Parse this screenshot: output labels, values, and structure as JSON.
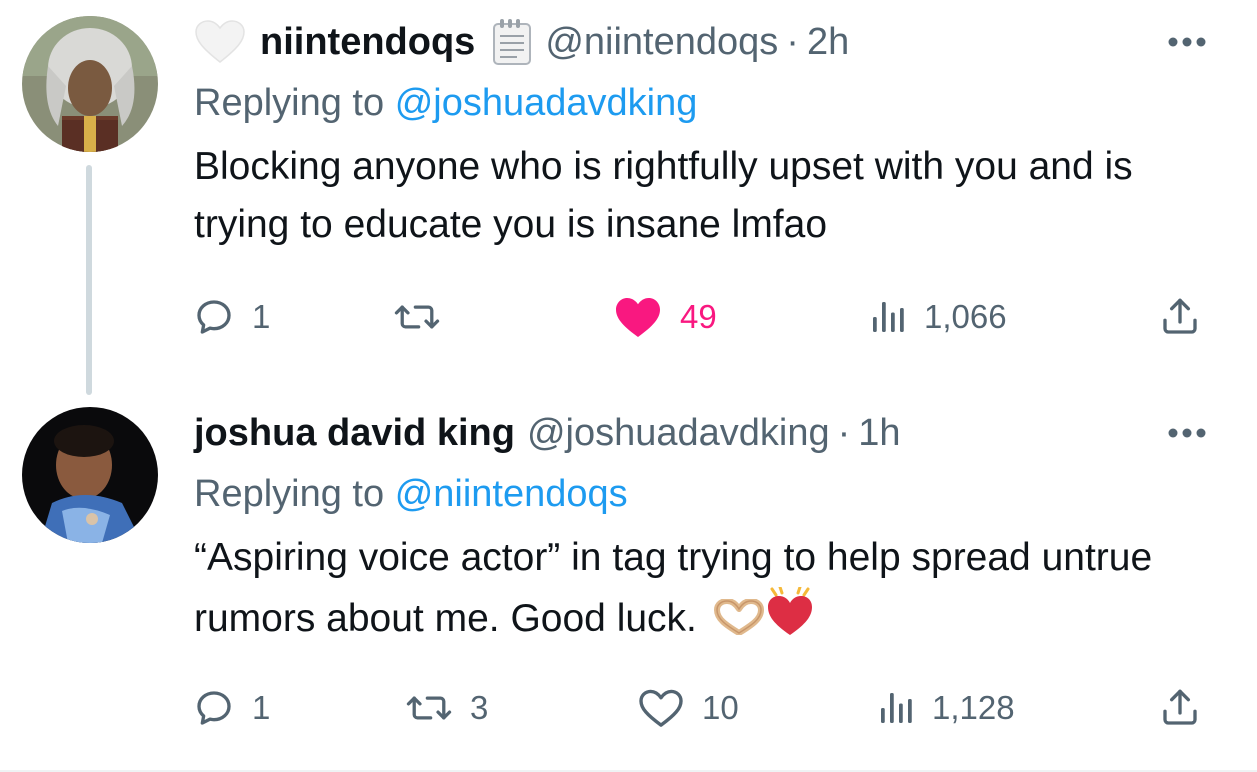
{
  "tweets": [
    {
      "display_name": "niintendoqs",
      "handle": "@niintendoqs",
      "separator": "·",
      "time": "2h",
      "replying_prefix": "Replying to",
      "replying_to": "@joshuadavdking",
      "text": "Blocking anyone who is rightfully upset with you and is trying to educate you is insane lmfao",
      "badges": [
        "white-heart-icon",
        "notepad-icon"
      ],
      "actions": {
        "replies": "1",
        "retweets": "",
        "likes": "49",
        "liked": true,
        "views": "1,066"
      }
    },
    {
      "display_name": "joshua david king",
      "handle": "@joshuadavdking",
      "separator": "·",
      "time": "1h",
      "replying_prefix": "Replying to",
      "replying_to": "@niintendoqs",
      "text": "“Aspiring voice actor” in tag trying to help spread untrue rumors about me. Good luck.",
      "emoji": [
        "heart-hands-icon",
        "beating-heart-icon"
      ],
      "actions": {
        "replies": "1",
        "retweets": "3",
        "likes": "10",
        "liked": false,
        "views": "1,128"
      }
    }
  ],
  "colors": {
    "text": "#0f1419",
    "secondary": "#536471",
    "link": "#1d9bf0",
    "like": "#f91880",
    "thread_line": "#cfd9de"
  }
}
